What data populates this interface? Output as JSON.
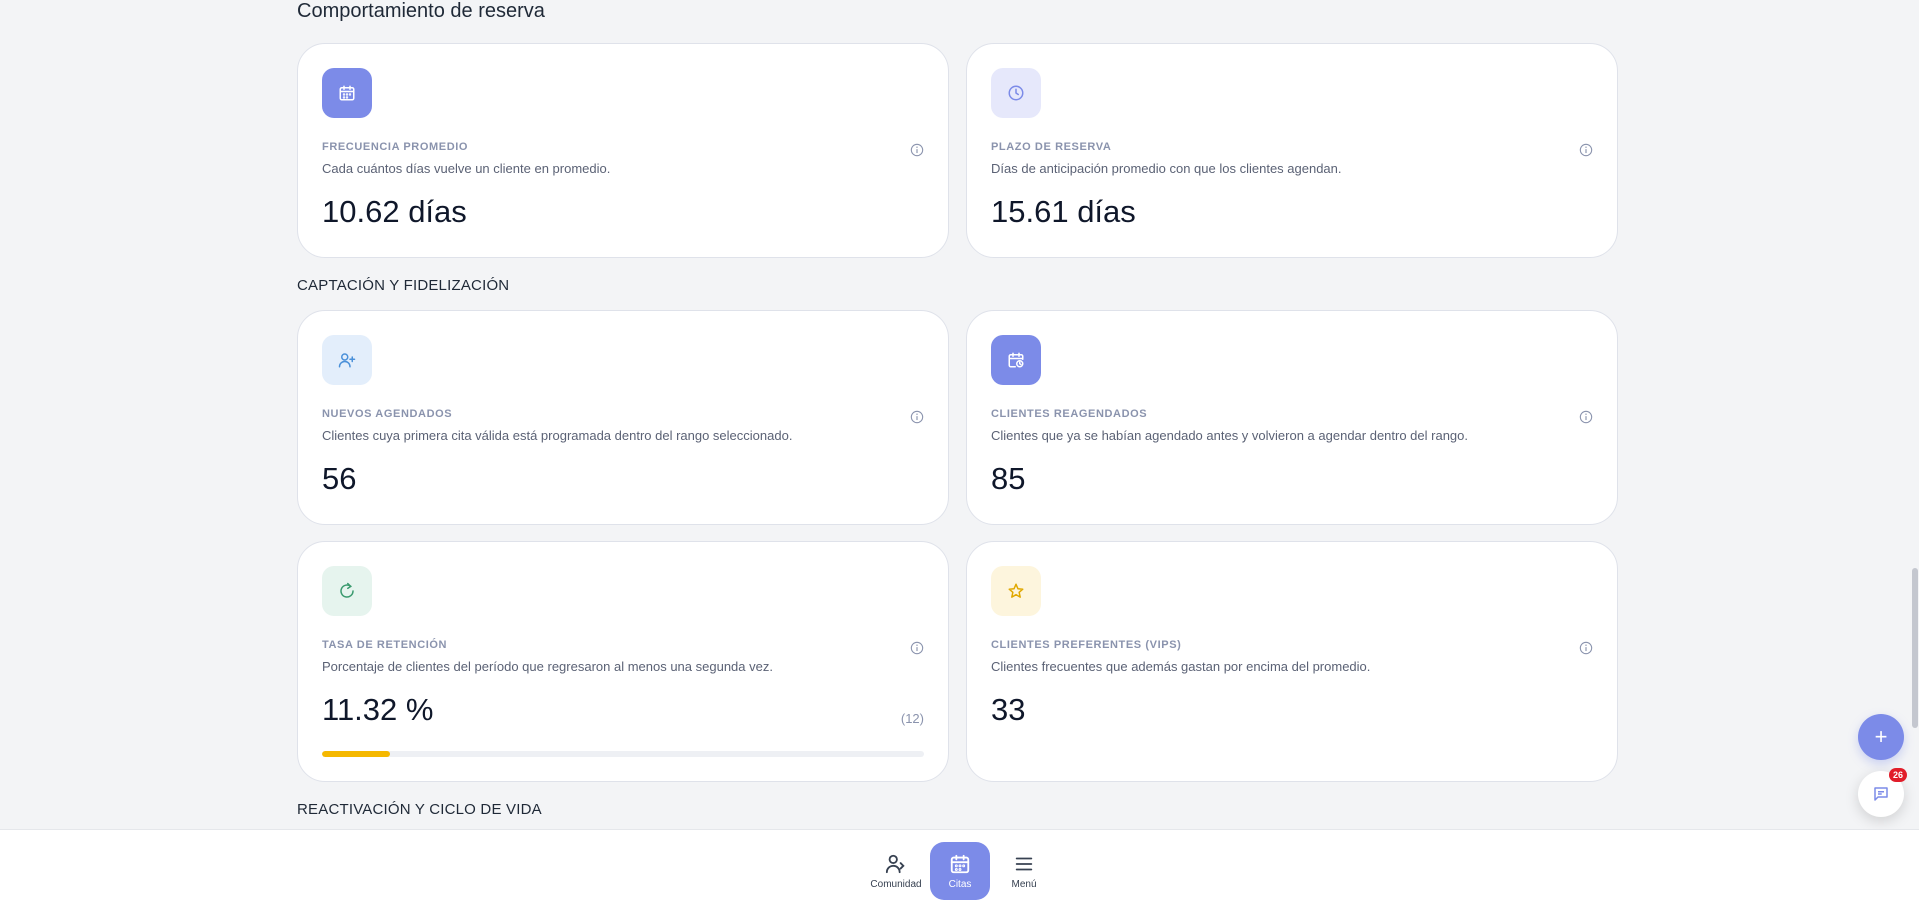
{
  "sections": {
    "booking_behavior": "Comportamiento de reserva",
    "acquisition": "CAPTACIÓN Y FIDELIZACIÓN",
    "reactivation": "REACTIVACIÓN Y CICLO DE VIDA"
  },
  "cards": {
    "avg_frequency": {
      "icon": "calendar-icon",
      "label": "FRECUENCIA PROMEDIO",
      "desc": "Cada cuántos días vuelve un cliente en promedio.",
      "value": "10.62 días"
    },
    "booking_lead": {
      "icon": "clock-icon",
      "label": "PLAZO DE RESERVA",
      "desc": "Días de anticipación promedio con que los clientes agendan.",
      "value": "15.61 días"
    },
    "new_bookings": {
      "icon": "user-plus-icon",
      "label": "NUEVOS AGENDADOS",
      "desc": "Clientes cuya primera cita válida está programada dentro del rango seleccionado.",
      "value": "56"
    },
    "rebooked": {
      "icon": "calendar-clock-icon",
      "label": "CLIENTES REAGENDADOS",
      "desc": "Clientes que ya se habían agendado antes y volvieron a agendar dentro del rango.",
      "value": "85"
    },
    "retention": {
      "icon": "refresh-icon",
      "label": "TASA DE RETENCIÓN",
      "desc": "Porcentaje de clientes del período que regresaron al menos una segunda vez.",
      "value": "11.32 %",
      "count": "(12)",
      "progress_percent": 11.32
    },
    "vips": {
      "icon": "star-icon",
      "label": "CLIENTES PREFERENTES (VIPS)",
      "desc": "Clientes frecuentes que además gastan por encima del promedio.",
      "value": "33"
    }
  },
  "nav": {
    "community": "Comunidad",
    "appointments": "Citas",
    "menu": "Menú"
  },
  "chat": {
    "badge": "26"
  },
  "colors": {
    "accent": "#7c8be8",
    "progress": "#f5b800",
    "badge": "#e11d2a"
  }
}
